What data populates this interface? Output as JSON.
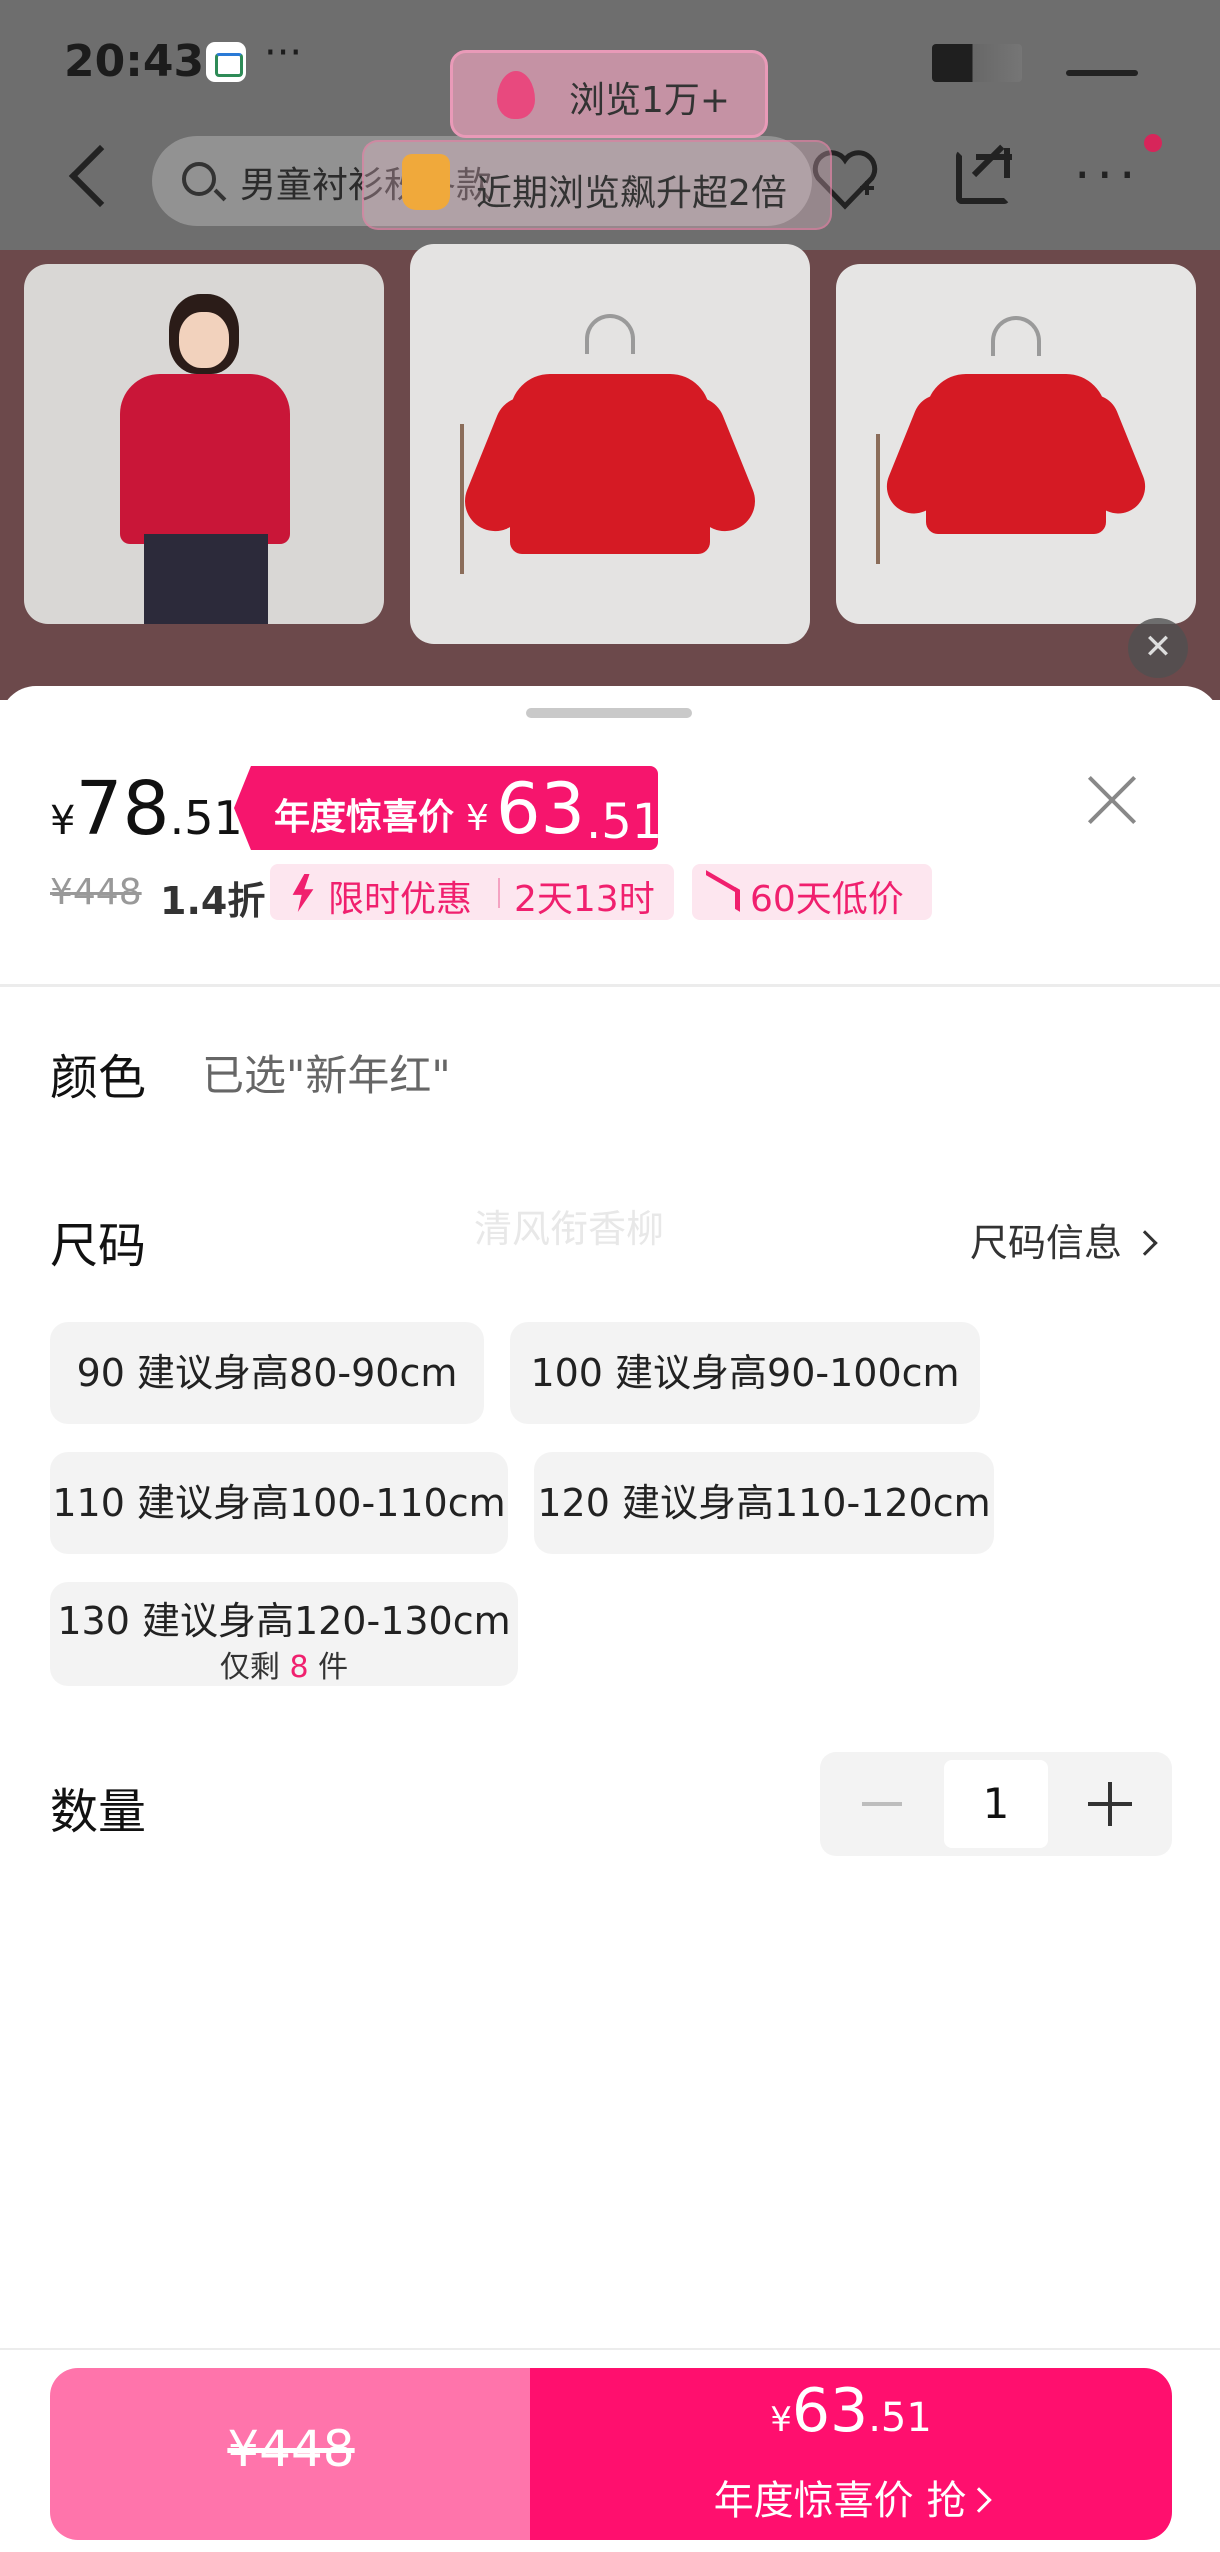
{
  "status_bar": {
    "time": "20:43",
    "dots": "···"
  },
  "nav": {
    "search_text": "男童衬衫秋冬款"
  },
  "overlays": {
    "views_pill": "浏览1万+",
    "trend_pill": "近期浏览飙升超2倍"
  },
  "price": {
    "currency": "¥",
    "main_int": "78",
    "main_dec": ".51",
    "annual_label": "年度惊喜价",
    "annual_int": "63",
    "annual_dec": ".51",
    "original": "¥448",
    "discount": "1.4折",
    "promo_label": "限时优惠",
    "promo_time": "2天13时",
    "low_price": "60天低价"
  },
  "color": {
    "label": "颜色",
    "value": "已选\"新年红\""
  },
  "size": {
    "label": "尺码",
    "info_link": "尺码信息",
    "watermark": "清风衔香柳",
    "options": [
      {
        "text": "90  建议身高80-90cm"
      },
      {
        "text": "100  建议身高90-100cm"
      },
      {
        "text": "110 建议身高100-110cm"
      },
      {
        "text": "120 建议身高110-120cm"
      },
      {
        "text": "130 建议身高120-130cm",
        "stock_prefix": "仅剩",
        "stock_num": "8",
        "stock_suffix": "件"
      }
    ]
  },
  "quantity": {
    "label": "数量",
    "value": "1"
  },
  "bottom_bar": {
    "original_price": "¥448",
    "currency": "¥",
    "price_int": "63",
    "price_dec": ".51",
    "cta": "年度惊喜价 抢"
  },
  "colors": {
    "accent": "#f6156d",
    "accent_light": "#ff74ab",
    "tag_bg": "#fde6ef"
  }
}
